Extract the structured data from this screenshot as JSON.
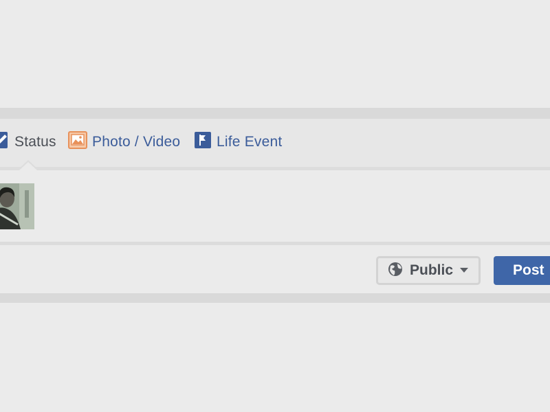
{
  "composer": {
    "tabs": [
      {
        "label": "Status",
        "icon": "pencil-icon"
      },
      {
        "label": "Photo / Video",
        "icon": "photo-icon"
      },
      {
        "label": "Life Event",
        "icon": "flag-icon"
      }
    ],
    "active_tab": "Status",
    "avatar": "profile-photo",
    "audience": {
      "label": "Public",
      "icon": "globe-icon"
    },
    "post_label": "Post"
  },
  "colors": {
    "background": "#ebebeb",
    "link_blue": "#3b5c9a",
    "post_button": "#3f66a8",
    "photo_icon_orange": "#e8915a",
    "text_dark": "#4b4f56"
  }
}
